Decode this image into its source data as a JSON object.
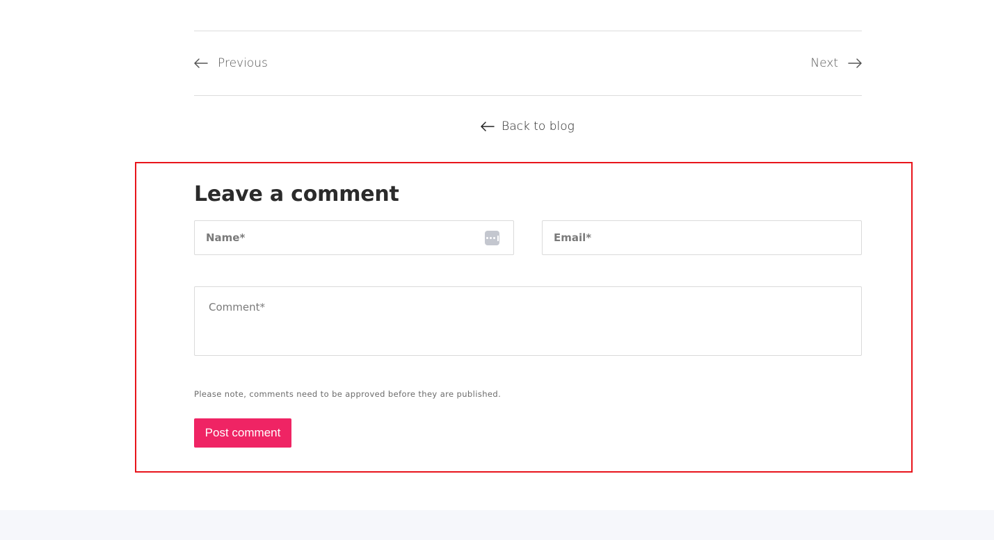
{
  "pagination": {
    "previous_label": "Previous",
    "next_label": "Next"
  },
  "back_link": {
    "label": "Back to blog"
  },
  "comment_form": {
    "title": "Leave a comment",
    "name_placeholder": "Name*",
    "email_placeholder": "Email*",
    "comment_placeholder": "Comment*",
    "note": "Please note, comments need to be approved before they are published.",
    "submit_label": "Post comment"
  },
  "colors": {
    "accent": "#ef2464",
    "highlight_border": "#e8141b",
    "footer_background": "#f6f7fb"
  }
}
